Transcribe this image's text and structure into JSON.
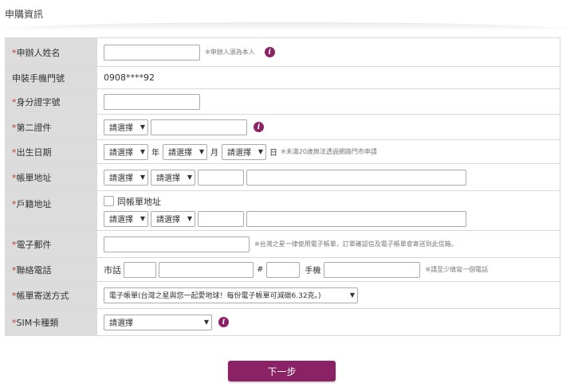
{
  "header": {
    "title": "申購資訊"
  },
  "fields": {
    "applicant_name": {
      "label": "申辦人姓名",
      "note": "※申辦人須為本人"
    },
    "phone": {
      "label": "申裝手機門號",
      "value": "0908****92"
    },
    "id_number": {
      "label": "身分證字號"
    },
    "second_id": {
      "label": "第二證件",
      "select": "請選擇"
    },
    "birthday": {
      "label": "出生日期",
      "year_select": "請選擇",
      "year_unit": "年",
      "month_select": "請選擇",
      "month_unit": "月",
      "day_select": "請選擇",
      "day_unit": "日",
      "note": "※未滿20歲無法透過網路門市申請"
    },
    "billing_address": {
      "label": "帳單地址",
      "city_select": "請選擇",
      "district_select": "請選擇"
    },
    "household_address": {
      "label": "戶籍地址",
      "same_as_label": "同帳單地址",
      "city_select": "請選擇",
      "district_select": "請選擇"
    },
    "email": {
      "label": "電子郵件",
      "note": "※台灣之星一律使用電子帳單，訂單確認信及電子帳單會寄送到此信箱。"
    },
    "contact_phone": {
      "label": "聯絡電話",
      "landline_label": "市話",
      "ext_label": "#",
      "mobile_label": "手機",
      "note": "※請至少填寫一個電話"
    },
    "bill_delivery": {
      "label": "帳單寄送方式",
      "select": "電子帳單(台灣之星與您一起愛地球！每份電子帳單可減碳6.32克。)"
    },
    "sim_type": {
      "label": "SIM卡種類",
      "select": "請選擇"
    }
  },
  "required_mark": "*",
  "info_icon_glyph": "i",
  "dropdown_arrow": "▼",
  "next_button": "下一步",
  "colors": {
    "accent": "#8b2266",
    "label_bg": "#dcdcdc",
    "required": "#c0392b"
  }
}
